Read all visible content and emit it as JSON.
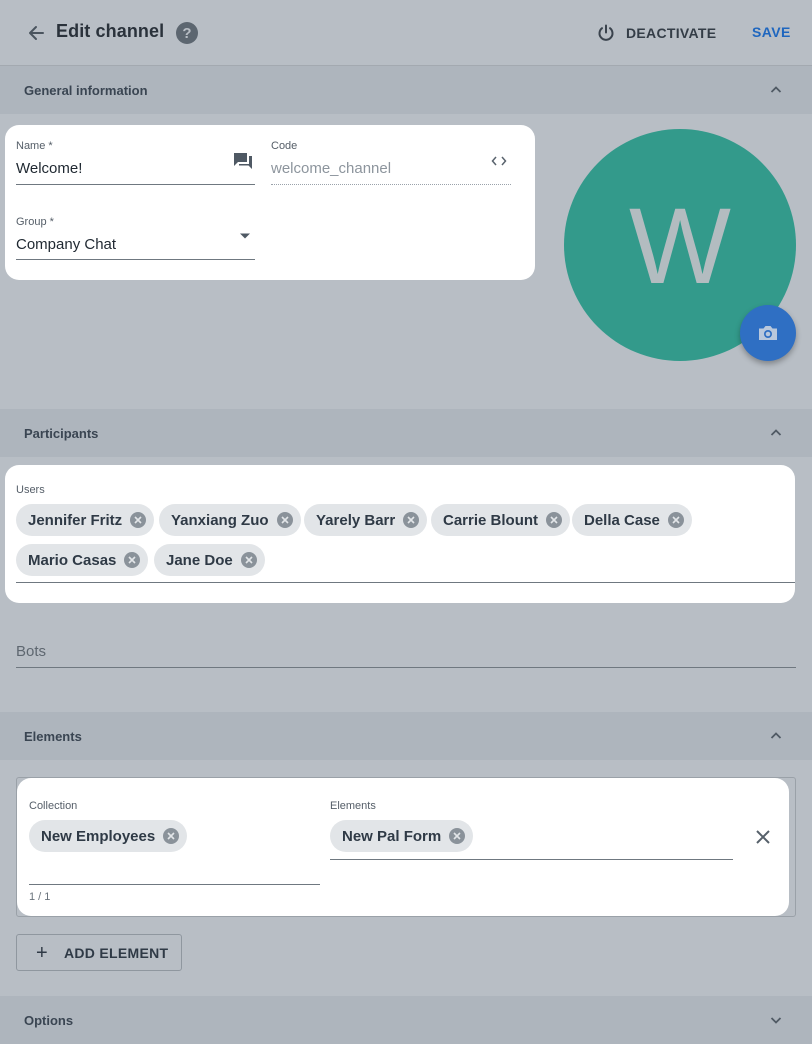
{
  "header": {
    "title": "Edit channel",
    "help_label": "?",
    "deactivate_label": "DEACTIVATE",
    "save_label": "SAVE"
  },
  "general": {
    "section_label": "General information",
    "name": {
      "label": "Name *",
      "value": "Welcome!"
    },
    "code": {
      "label": "Code",
      "placeholder": "welcome_channel"
    },
    "group": {
      "label": "Group *",
      "value": "Company Chat"
    },
    "avatar_letter": "W"
  },
  "participants": {
    "section_label": "Participants",
    "users_label": "Users",
    "users": [
      "Jennifer Fritz",
      "Yanxiang Zuo",
      "Yarely Barr",
      "Carrie Blount",
      "Della Case",
      "Mario Casas",
      "Jane Doe"
    ],
    "bots_label": "Bots"
  },
  "elements": {
    "section_label": "Elements",
    "collection_label": "Collection",
    "collection_value": "New Employees",
    "counter": "1 / 1",
    "elements_label": "Elements",
    "elements_value": "New Pal Form",
    "add_element_label": "ADD ELEMENT",
    "add_icon": "+"
  },
  "options": {
    "section_label": "Options"
  },
  "colors": {
    "background": "#b8bec5",
    "section_bar": "#aeb5bd",
    "accent": "#1e66bf",
    "avatar": "#339a8b",
    "camera_button": "#2f6fc3"
  },
  "icons": [
    "back-arrow-icon",
    "help-icon",
    "power-icon",
    "chevron-up-icon",
    "chevron-down-icon",
    "chat-icon",
    "code-icon",
    "dropdown-arrow-icon",
    "camera-icon",
    "chip-remove-icon",
    "close-icon",
    "plus-icon"
  ]
}
